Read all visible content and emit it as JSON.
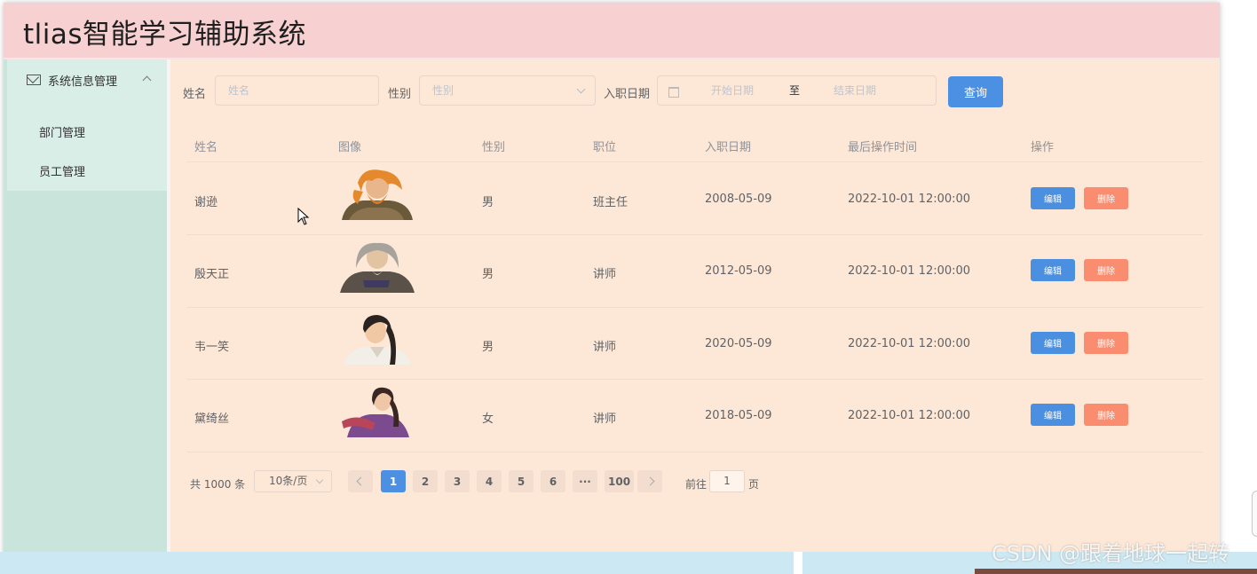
{
  "app": {
    "title": "tlias智能学习辅助系统"
  },
  "sidebar": {
    "group_label": "系统信息管理",
    "items": [
      {
        "label": "部门管理"
      },
      {
        "label": "员工管理"
      }
    ]
  },
  "filters": {
    "name_label": "姓名",
    "name_placeholder": "姓名",
    "gender_label": "性别",
    "gender_placeholder": "性别",
    "date_label": "入职日期",
    "start_placeholder": "开始日期",
    "range_separator": "至",
    "end_placeholder": "结束日期",
    "query_button": "查询"
  },
  "table": {
    "headers": [
      "姓名",
      "图像",
      "性别",
      "职位",
      "入职日期",
      "最后操作时间",
      "操作"
    ],
    "rows": [
      {
        "name": "谢逊",
        "avatar": "orange-haired-warrior",
        "gender": "男",
        "position": "班主任",
        "entry_date": "2008-05-09",
        "update_time": "2022-10-01 12:00:00",
        "edit": "编辑",
        "delete": "删除"
      },
      {
        "name": "殷天正",
        "avatar": "grey-haired-elder",
        "gender": "男",
        "position": "讲师",
        "entry_date": "2012-05-09",
        "update_time": "2022-10-01 12:00:00",
        "edit": "编辑",
        "delete": "删除"
      },
      {
        "name": "韦一笑",
        "avatar": "young-swordsman",
        "gender": "男",
        "position": "讲师",
        "entry_date": "2020-05-09",
        "update_time": "2022-10-01 12:00:00",
        "edit": "编辑",
        "delete": "删除"
      },
      {
        "name": "黛绮丝",
        "avatar": "purple-robed-woman",
        "gender": "女",
        "position": "讲师",
        "entry_date": "2018-05-09",
        "update_time": "2022-10-01 12:00:00",
        "edit": "编辑",
        "delete": "删除"
      }
    ]
  },
  "pagination": {
    "total": "共 1000 条",
    "page_size": "10条/页",
    "pages": [
      "1",
      "2",
      "3",
      "4",
      "5",
      "6",
      "···",
      "100"
    ],
    "current": "1",
    "goto_label": "前往",
    "goto_value": "1",
    "page_suffix": "页"
  },
  "watermark": "CSDN @跟着地球一起转",
  "colors": {
    "header_bg": "#f7d1d1",
    "sidebar_bg": "#c9e4da",
    "main_bg": "#fde7d6",
    "primary": "#4b90e2",
    "danger": "#fa8c6f"
  }
}
